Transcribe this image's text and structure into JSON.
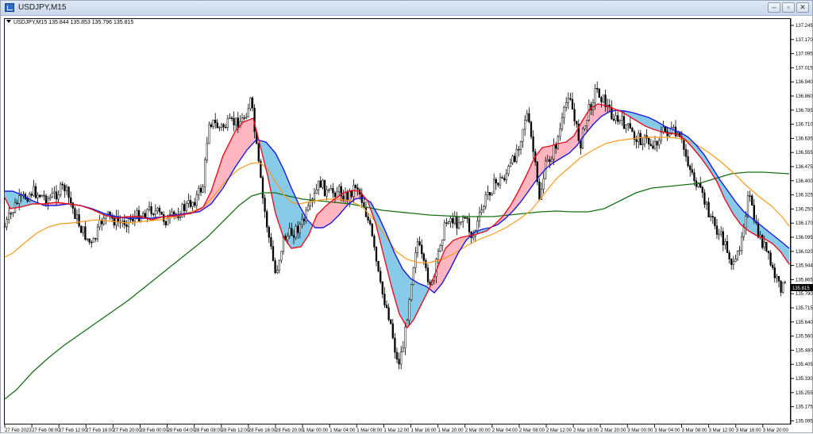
{
  "window": {
    "title": "USDJPY,M15",
    "minimize_label": "–",
    "restore_label": "▫",
    "close_label": "✕"
  },
  "chart": {
    "symbol_info": "USDJPY,M15  135.844 135.853 135.796 135.815",
    "current_price": "135.815",
    "price_levels": [
      "137.245",
      "137.170",
      "137.095",
      "137.015",
      "136.940",
      "136.860",
      "136.785",
      "136.710",
      "136.635",
      "136.555",
      "136.475",
      "136.400",
      "136.325",
      "136.250",
      "136.170",
      "136.095",
      "136.020",
      "135.944",
      "135.865",
      "135.790",
      "135.715",
      "135.640",
      "135.560",
      "135.480",
      "135.405",
      "135.330",
      "135.255",
      "135.175",
      "135.095"
    ],
    "time_labels": [
      "27 Feb 2023",
      "27 Feb 08:00",
      "27 Feb 12:00",
      "27 Feb 16:00",
      "27 Feb 20:00",
      "28 Feb 00:00",
      "28 Feb 04:00",
      "28 Feb 08:00",
      "28 Feb 12:00",
      "28 Feb 16:00",
      "28 Feb 20:00",
      "1 Mar 00:00",
      "1 Mar 04:00",
      "1 Mar 08:00",
      "1 Mar 12:00",
      "1 Mar 16:00",
      "1 Mar 20:00",
      "2 Mar 00:00",
      "2 Mar 04:00",
      "2 Mar 08:00",
      "2 Mar 12:00",
      "2 Mar 16:00",
      "2 Mar 20:00",
      "3 Mar 00:00",
      "3 Mar 04:00",
      "3 Mar 08:00",
      "3 Mar 12:00",
      "3 Mar 16:00",
      "3 Mar 20:00"
    ],
    "colors": {
      "red_line": "#e8101c",
      "blue_line": "#1a1adf",
      "orange_line": "#ff9a1a",
      "green_line": "#167016",
      "bull_fill": "#ffb6c1",
      "bear_fill": "#87cbe8",
      "candle": "#000000"
    }
  }
}
